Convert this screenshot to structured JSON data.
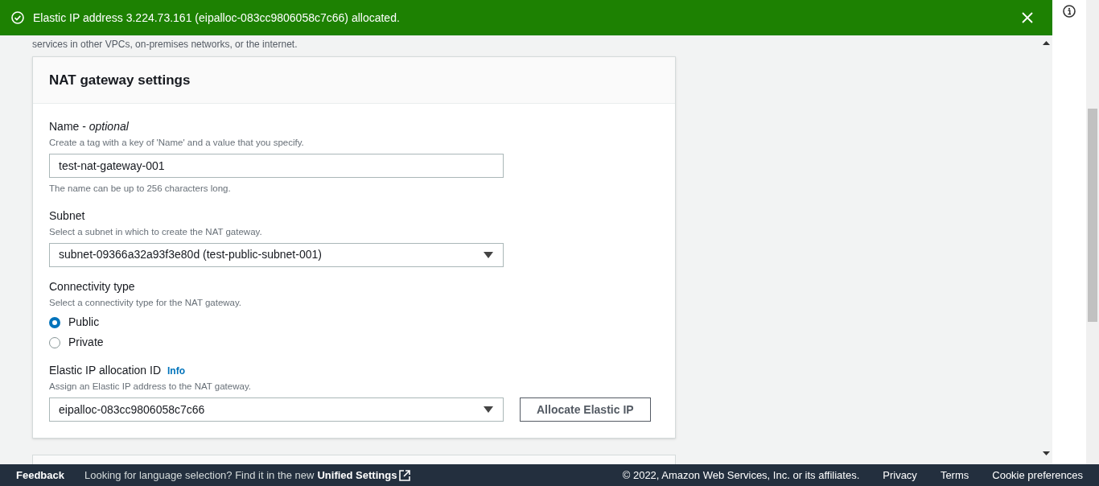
{
  "flash_banner": {
    "kind": "success",
    "message": "Elastic IP address 3.224.73.161 (eipalloc-083cc9806058c7c66) allocated."
  },
  "intro_text": "services in other VPCs, on-premises networks, or the internet.",
  "panel": {
    "title": "NAT gateway settings",
    "fields": [
      {
        "kind": "text",
        "label": "Name - ",
        "label_suffix": "optional",
        "description": "Create a tag with a key of 'Name' and a value that you specify.",
        "value": "test-nat-gateway-001",
        "constraint": "The name can be up to 256 characters long."
      },
      {
        "kind": "select",
        "label": "Subnet",
        "description": "Select a subnet in which to create the NAT gateway.",
        "value": "subnet-09366a32a93f3e80d (test-public-subnet-001)"
      },
      {
        "kind": "radio",
        "label": "Connectivity type",
        "description": "Select a connectivity type for the NAT gateway.",
        "options": [
          {
            "label": "Public",
            "selected": true
          },
          {
            "label": "Private",
            "selected": false
          }
        ]
      },
      {
        "kind": "select",
        "label": "Elastic IP allocation ID",
        "info": "Info",
        "description": "Assign an Elastic IP address to the NAT gateway.",
        "value": "eipalloc-083cc9806058c7c66",
        "button": "Allocate Elastic IP"
      }
    ]
  },
  "footer": {
    "feedback": "Feedback",
    "language_note": "Looking for language selection? Find it in the new ",
    "language_link": "Unified Settings",
    "copyright": "© 2022, Amazon Web Services, Inc. or its affiliates.",
    "links": [
      "Privacy",
      "Terms",
      "Cookie preferences"
    ]
  }
}
